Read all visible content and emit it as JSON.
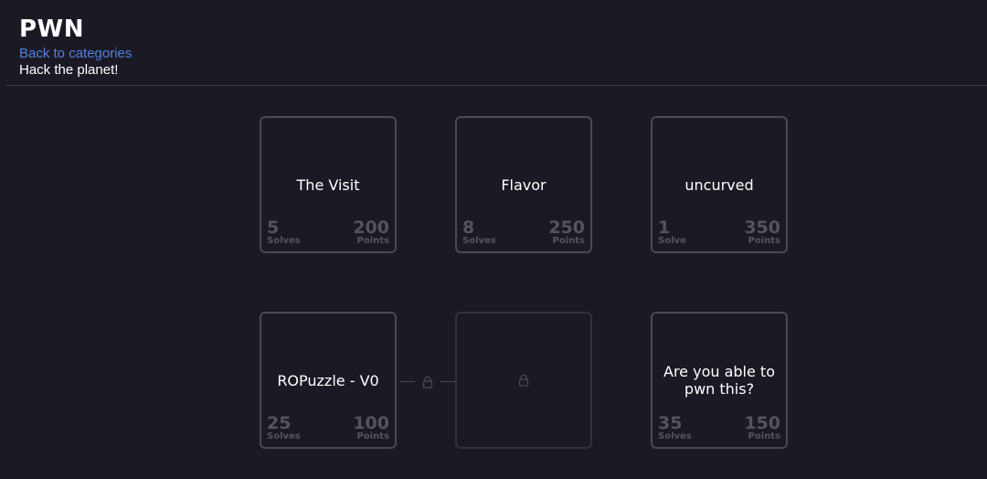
{
  "header": {
    "title": "PWN",
    "back_link": "Back to categories",
    "subtitle": "Hack the planet!"
  },
  "challenges": [
    {
      "title": "The Visit",
      "solves": "5",
      "solves_label": "Solves",
      "points": "200",
      "points_label": "Points"
    },
    {
      "title": "Flavor",
      "solves": "8",
      "solves_label": "Solves",
      "points": "250",
      "points_label": "Points"
    },
    {
      "title": "uncurved",
      "solves": "1",
      "solves_label": "Solve",
      "points": "350",
      "points_label": "Points"
    },
    {
      "title": "ROPuzzle - V0",
      "solves": "25",
      "solves_label": "Solves",
      "points": "100",
      "points_label": "Points"
    },
    {
      "title": "Are you able to pwn this?",
      "solves": "35",
      "solves_label": "Solves",
      "points": "150",
      "points_label": "Points"
    }
  ],
  "locked_challenge": {
    "icon": "lock-icon"
  },
  "colors": {
    "background": "#1b1a24",
    "link": "#4f82e0",
    "card_border": "#4a4953",
    "muted_text": "#55545d"
  }
}
